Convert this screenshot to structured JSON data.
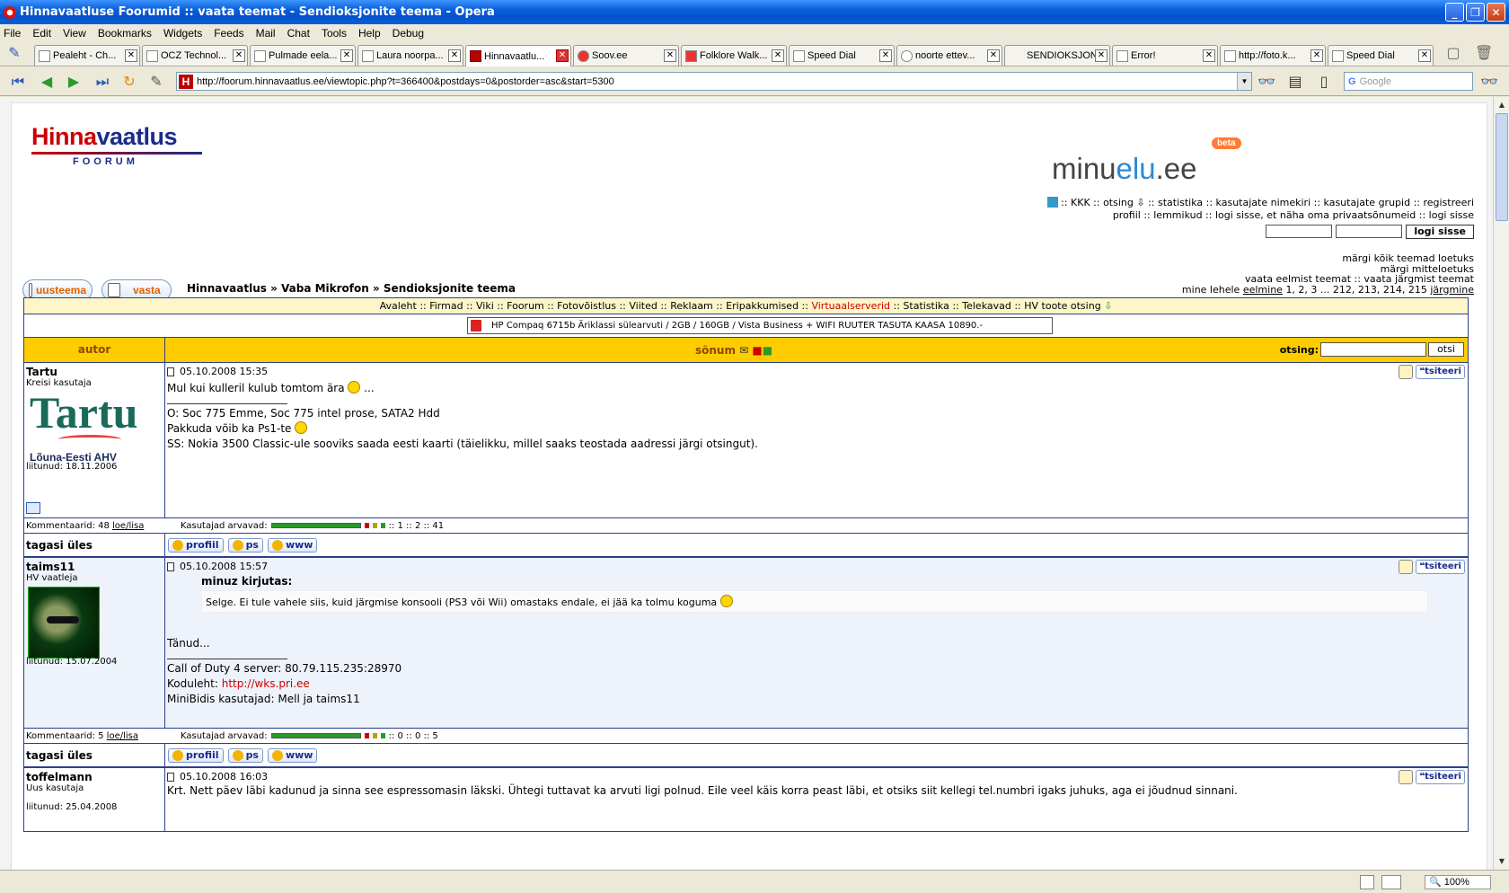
{
  "window": {
    "title": "Hinnavaatluse Foorumid :: vaata teemat - Sendioksjonite teema - Opera"
  },
  "menu": [
    "File",
    "Edit",
    "View",
    "Bookmarks",
    "Widgets",
    "Feeds",
    "Mail",
    "Chat",
    "Tools",
    "Help",
    "Debug"
  ],
  "tabs": [
    {
      "label": "Pealeht - Ch..."
    },
    {
      "label": "OCZ Technol..."
    },
    {
      "label": "Pulmade eela..."
    },
    {
      "label": "Laura noorpa..."
    },
    {
      "label": "Hinnavaatlu..."
    },
    {
      "label": "Soov.ee"
    },
    {
      "label": "Folklore Walk..."
    },
    {
      "label": "Speed Dial"
    },
    {
      "label": "noorte ettev..."
    },
    {
      "label": "SENDIOKSJON"
    },
    {
      "label": "Error!"
    },
    {
      "label": "http://foto.k..."
    },
    {
      "label": "Speed Dial"
    }
  ],
  "address": {
    "url": "http://foorum.hinnavaatlus.ee/viewtopic.php?t=366400&postdays=0&postorder=asc&start=5300"
  },
  "search": {
    "placeholder": "Google"
  },
  "status": {
    "zoom": "100%"
  },
  "header": {
    "logo_main": "Hinna",
    "logo_main2": "vaatlus",
    "logo_sub": "FOORUM",
    "minuelu_a": "minu",
    "minuelu_b": "elu",
    "minuelu_c": ".ee",
    "minuelu_beta": "beta",
    "toplinks_line1": " :: KKK  :: otsing ⇩  :: statistika  :: kasutajate nimekiri  :: kasutajate grupid  :: registreeri",
    "toplinks_line2": "profiil  :: lemmikud  :: logi sisse, et näha oma privaatsõnumeid  :: logi sisse",
    "login_button": "logi sisse"
  },
  "rightnav": {
    "line1": "märgi kõik teemad loetuks",
    "line2": "märgi mitteloetuks",
    "line3": "vaata eelmist teemat :: vaata järgmist teemat",
    "pages_prefix": "mine lehele",
    "pages_prev": "eelmine",
    "pages_list": "1, 2, 3 ... 212, 213, 214, 215",
    "pages_next": "järgmine"
  },
  "buttons": {
    "new_topic": "uusteema",
    "reply": "vasta"
  },
  "breadcrumb": "Hinnavaatlus » Vaba Mikrofon » Sendioksjonite teema",
  "linkbar": {
    "part1": "Avaleht :: Firmad :: Viki :: Foorum :: Fotovõistlus :: Viited :: Reklaam :: Eripakkumised :: ",
    "red": "Virtuaalserverid",
    "part2": " :: Statistika :: Telekavad :: HV toote otsing"
  },
  "ad": "HP Compaq 6715b Äriklassi sülearvuti / 2GB / 160GB / Vista Business + WIFI RUUTER TASUTA KAASA 10890.-",
  "table_header": {
    "author": "autor",
    "message": "sõnum",
    "search_label": "otsing:",
    "search_button": "otsi"
  },
  "posts": [
    {
      "author": "Tartu",
      "rank": "Kreisi kasutaja",
      "avatar_text": "Tartu",
      "avatar_sub": "Lõuna-Eesti AHV",
      "joined": "liitunud: 18.11.2006",
      "date": "05.10.2008 15:35",
      "quote_button": "tsiteeri",
      "line1": "Mul kui kulleril kulub tomtom ära",
      "line1_tail": " ...",
      "sig1": "O: Soc 775 Emme, Soc 775 intel prose, SATA2 Hdd",
      "sig2": "Pakkuda võib ka Ps1-te",
      "sig3": "SS: Nokia 3500 Classic-ule sooviks saada eesti kaarti (täielikku, millel saaks teostada aadressi järgi otsingut).",
      "comments_label": "Kommentaarid: 48",
      "comments_link": "loe/lisa",
      "ratings_label": "Kasutajad arvavad:",
      "ratings": "::  1  ::  2  ::  41",
      "back": "tagasi üles",
      "btn_profile": "profiil",
      "btn_pm": "ps",
      "btn_www": "www"
    },
    {
      "author": "taims11",
      "rank": "HV vaatleja",
      "joined": "liitunud: 15.07.2004",
      "date": "05.10.2008 15:57",
      "quote_button": "tsiteeri",
      "quote_author": "minuz kirjutas:",
      "quote_text": "Selge. Ei tule vahele siis, kuid järgmise konsooli (PS3 või Wii) omastaks endale, ei jää ka tolmu koguma",
      "line1": "Tänud...",
      "sig1": "Call of Duty 4 server: 80.79.115.235:28970",
      "sig2_label": "Koduleht: ",
      "sig2_link": "http://wks.pri.ee",
      "sig3": "MiniBidis kasutajad: Mell ja taims11",
      "comments_label": "Kommentaarid: 5",
      "comments_link": "loe/lisa",
      "ratings_label": "Kasutajad arvavad:",
      "ratings": "::  0  ::  0  ::  5",
      "back": "tagasi üles",
      "btn_profile": "profiil",
      "btn_pm": "ps",
      "btn_www": "www"
    },
    {
      "author": "toffelmann",
      "rank": "Uus kasutaja",
      "joined": "liitunud: 25.04.2008",
      "date": "05.10.2008 16:03",
      "quote_button": "tsiteeri",
      "line1": "Krt. Nett päev läbi kadunud ja sinna see espressomasin läkski. Ühtegi tuttavat ka arvuti ligi polnud. Eile veel käis korra peast läbi, et otsiks siit kellegi tel.numbri igaks juhuks, aga ei jõudnud sinnani."
    }
  ]
}
